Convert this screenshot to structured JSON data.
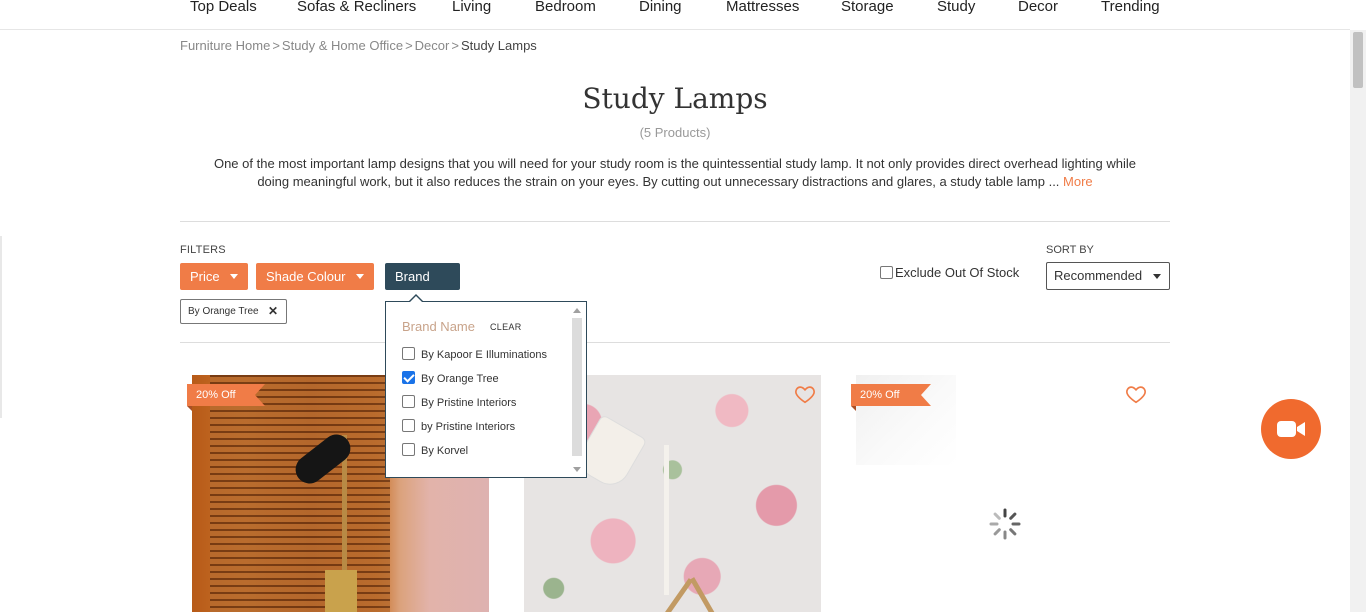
{
  "nav": {
    "items": [
      "Top Deals",
      "Sofas & Recliners",
      "Living",
      "Bedroom",
      "Dining",
      "Mattresses",
      "Storage",
      "Study",
      "Decor",
      "Trending"
    ]
  },
  "breadcrumb": {
    "items": [
      "Furniture Home",
      "Study & Home Office",
      "Decor"
    ],
    "current": "Study Lamps",
    "separator": ">"
  },
  "page": {
    "title": "Study Lamps",
    "count": "(5 Products)",
    "description_line1": "One of the most important lamp designs that you will need for your study room is the quintessential study lamp. It not only provides direct overhead lighting while",
    "description_line2": "doing meaningful work, but it also reduces the strain on your eyes. By cutting out unnecessary distractions and glares, a study table lamp ...",
    "more": "More"
  },
  "filters": {
    "label": "FILTERS",
    "buttons": [
      "Price",
      "Shade Colour",
      "Brand"
    ],
    "applied_chip": "By Orange Tree",
    "exclude_out_of_stock": "Exclude Out Of Stock",
    "exclude_checked": false
  },
  "sort": {
    "label": "SORT BY",
    "value": "Recommended"
  },
  "brand_dropdown": {
    "header": "Brand Name",
    "clear": "CLEAR",
    "options": [
      {
        "label": "By Kapoor E Illuminations",
        "checked": false
      },
      {
        "label": "By Orange Tree",
        "checked": true
      },
      {
        "label": "By Pristine Interiors",
        "checked": false
      },
      {
        "label": "by Pristine Interiors",
        "checked": false
      },
      {
        "label": "By Korvel",
        "checked": false
      }
    ]
  },
  "products": [
    {
      "discount": "20% Off"
    },
    {
      "discount": "20% Off"
    },
    {
      "discount": "20% Off"
    }
  ],
  "icons": {
    "close": "close-icon",
    "heart": "heart-icon",
    "video": "video-camera-icon",
    "spinner": "loading-spinner-icon"
  },
  "colors": {
    "accent": "#f07c47",
    "active_filter": "#2e4a5a",
    "video_button": "#f06a2e",
    "checkbox_checked": "#1a73e8"
  }
}
